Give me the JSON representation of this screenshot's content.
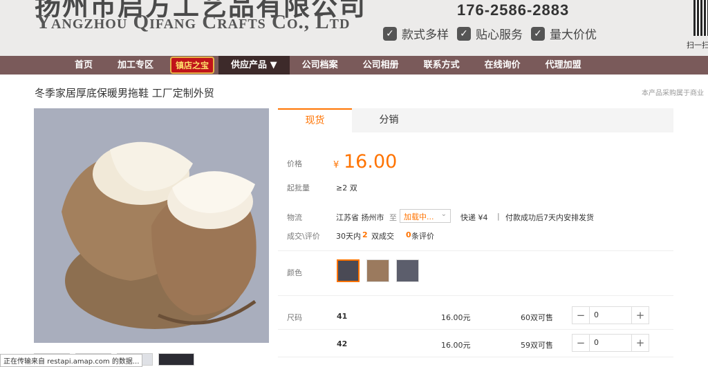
{
  "banner": {
    "company_cn": "扬州市启方工艺品有限公司",
    "company_en": "Yangzhou Qifang Crafts Co., Ltd",
    "phone": "176-2586-2883",
    "features": [
      "款式多样",
      "贴心服务",
      "量大价优"
    ],
    "qr_label": "扫一扫"
  },
  "nav": {
    "items": [
      "首页",
      "加工专区"
    ],
    "badge": "镇店之宝",
    "active": "供应产品 ▼",
    "items_after": [
      "公司档案",
      "公司相册",
      "联系方式",
      "在线询价",
      "代理加盟"
    ]
  },
  "product": {
    "title": "冬季家居厚底保暖男拖鞋 工厂定制外贸",
    "note": "本产品采购属于商业"
  },
  "tabs": [
    "现货",
    "分销"
  ],
  "price": {
    "label": "价格",
    "symbol": "¥",
    "value": "16.00",
    "min_label": "起批量",
    "min_value": "≥2 双"
  },
  "logistics": {
    "label": "物流",
    "origin": "江苏省 扬州市",
    "to": "至",
    "destination": "加载中...",
    "express": "快递 ¥4",
    "ship_note": "付款成功后7天内安排发货"
  },
  "deals": {
    "label": "成交\\评价",
    "days": "30天内",
    "count": "2",
    "unit": "双成交",
    "reviews": "0",
    "reviews_unit": "条评价"
  },
  "color_label": "颜色",
  "size_label": "尺码",
  "sizes": [
    {
      "size": "41",
      "price": "16.00元",
      "stock": "60双可售",
      "qty": "0"
    },
    {
      "size": "42",
      "price": "16.00元",
      "stock": "59双可售",
      "qty": "0"
    }
  ],
  "status_text": "正在传输来自 restapi.amap.com 的数据..."
}
